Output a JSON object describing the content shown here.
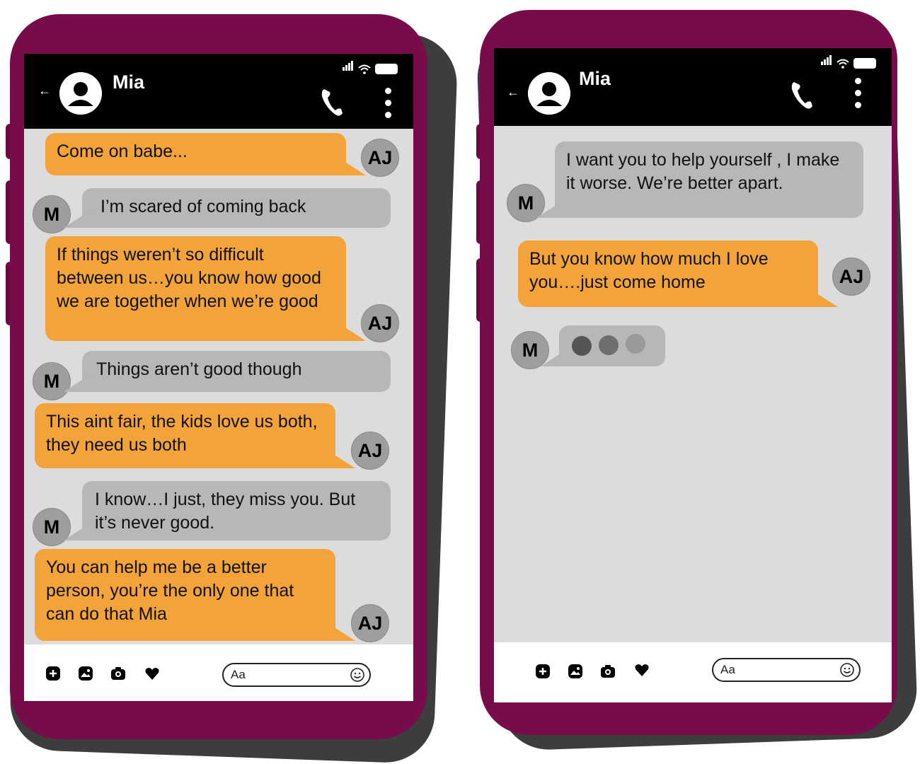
{
  "colors": {
    "phone_frame": "#780b4a",
    "outgoing_bubble": "#f2a43a",
    "incoming_bubble": "#b7b7b7",
    "screen_bg": "#dcdcdc",
    "header_bg": "#000000"
  },
  "phones": [
    {
      "header": {
        "contact_name": "Mia",
        "back_icon": "back-arrow-icon",
        "call_icon": "phone-icon",
        "more_icon": "more-vertical-icon"
      },
      "messages": [
        {
          "from": "AJ",
          "direction": "out",
          "text": "Come on babe..."
        },
        {
          "from": "M",
          "direction": "in",
          "text": "I’m scared of coming back"
        },
        {
          "from": "AJ",
          "direction": "out",
          "text": "If things weren’t so difficult between us…you know how good we are together when we’re good"
        },
        {
          "from": "M",
          "direction": "in",
          "text": "Things aren’t good though"
        },
        {
          "from": "AJ",
          "direction": "out",
          "text": "This aint fair, the kids love us both, they need us both"
        },
        {
          "from": "M",
          "direction": "in",
          "text": "I know…I just, they miss you. But it’s never good."
        },
        {
          "from": "AJ",
          "direction": "out",
          "text": "You can help me be a better person, you’re the only one that can do that Mia"
        }
      ],
      "composer": {
        "placeholder": "Aa",
        "icons": [
          "plus-icon",
          "gallery-icon",
          "camera-icon",
          "heart-icon",
          "emoji-icon"
        ]
      }
    },
    {
      "header": {
        "contact_name": "Mia",
        "back_icon": "back-arrow-icon",
        "call_icon": "phone-icon",
        "more_icon": "more-vertical-icon"
      },
      "messages": [
        {
          "from": "M",
          "direction": "in",
          "text": "I want you to help yourself , I make it worse.  We’re better apart."
        },
        {
          "from": "AJ",
          "direction": "out",
          "text": "But you know how much I love you….just come home"
        },
        {
          "from": "M",
          "direction": "in",
          "typing": true,
          "text": ""
        }
      ],
      "composer": {
        "placeholder": "Aa",
        "icons": [
          "plus-icon",
          "gallery-icon",
          "camera-icon",
          "heart-icon",
          "emoji-icon"
        ]
      }
    }
  ]
}
